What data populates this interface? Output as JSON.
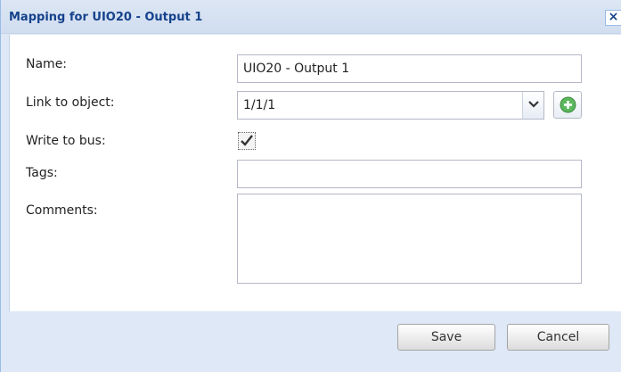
{
  "dialog": {
    "title": "Mapping for UIO20 - Output 1",
    "close_label": "×"
  },
  "form": {
    "name_label": "Name:",
    "name_value": "UIO20 - Output 1",
    "link_label": "Link to object:",
    "link_value": "1/1/1",
    "write_label": "Write to bus:",
    "write_checked": true,
    "tags_label": "Tags:",
    "tags_value": "",
    "comments_label": "Comments:",
    "comments_value": ""
  },
  "footer": {
    "save_label": "Save",
    "cancel_label": "Cancel"
  },
  "colors": {
    "title_text": "#15428b",
    "frame": "#dfe8f6",
    "add_icon": "#5cb85c"
  }
}
